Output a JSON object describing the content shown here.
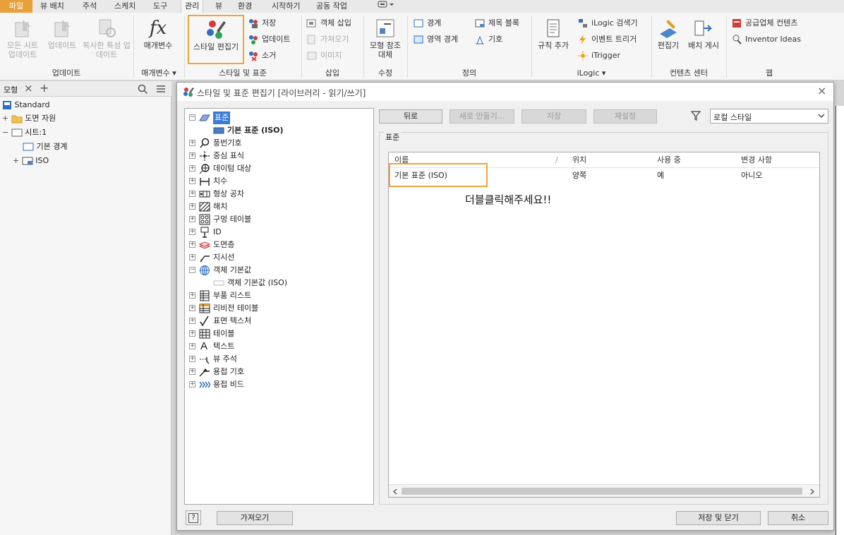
{
  "menu_tabs": [
    "파일",
    "뷰 배치",
    "주석",
    "스케치",
    "도구",
    "관리",
    "뷰",
    "환경",
    "시작하기",
    "공동 작업"
  ],
  "ribbon": {
    "update_group": {
      "label": "업데이트",
      "buttons": [
        "모든 시트 업데이트",
        "업데이트",
        "복사한 특성 업데이트"
      ]
    },
    "params_group": {
      "label": "매개변수 ▾",
      "button": "매개변수",
      "icon_text": "fx"
    },
    "styles_group": {
      "label": "스타일 및 표준",
      "big": "스타일 편집기",
      "save": "저장",
      "update": "업데이트",
      "purge": "소거"
    },
    "insert_group": {
      "label": "삽입",
      "items": [
        "객체 삽입",
        "가져오기",
        "이미지"
      ]
    },
    "modify_group": {
      "label": "수정",
      "big": "모형 참조 대체"
    },
    "define_group": {
      "label": "정의",
      "items": [
        "경계",
        "영역 경계",
        "제목 블록",
        "기호"
      ]
    },
    "ilogic_group": {
      "label": "iLogic ▾",
      "big": "규칙 추가",
      "items": [
        "iLogic 검색기",
        "이벤트 트리거",
        "iTrigger"
      ]
    },
    "content_group": {
      "label": "컨텐츠 센터",
      "items": [
        "편집기",
        "배치 게시"
      ]
    },
    "web_group": {
      "label": "웹",
      "items": [
        "공급업체 컨텐츠",
        "Inventor Ideas"
      ]
    }
  },
  "browser": {
    "tab": "모형",
    "nodes": [
      "Standard",
      "도면 자원",
      "시트:1",
      "기본 경계",
      "ISO"
    ]
  },
  "dialog": {
    "title": "스타일 및 표준 편집기 [라이브러리 - 읽기/쓰기]",
    "buttons": {
      "back": "뒤로",
      "new": "새로 만들기...",
      "save": "저장",
      "reset": "재설정"
    },
    "filter": "로컬 스타일",
    "section": "표준",
    "tree": [
      "표준",
      "기본 표준 (ISO)",
      "풍번기호",
      "중심 표식",
      "데이텀 대상",
      "치수",
      "형상 공차",
      "해치",
      "구멍 테이블",
      "ID",
      "도면층",
      "지시선",
      "객체 기본값",
      "객체 기본값 (ISO)",
      "부품 리스트",
      "리비전 테이블",
      "표면 텍스처",
      "테이블",
      "텍스트",
      "뷰 주석",
      "용접 기호",
      "용접 비드"
    ],
    "columns": [
      "이름",
      "위치",
      "사용 중",
      "변경 사항"
    ],
    "rows": [
      {
        "name": "기본 표준 (ISO)",
        "location": "양쪽",
        "in_use": "예",
        "changed": "아니오"
      }
    ],
    "annotation": "더블클릭해주세요!!",
    "import": "가져오기",
    "save_close": "저장 및 닫기",
    "cancel": "취소",
    "help": "?"
  },
  "colors": {
    "highlight": "#f0a43a",
    "file_tab": "#e8a13a",
    "tree_selected": "#3a7bd5"
  }
}
